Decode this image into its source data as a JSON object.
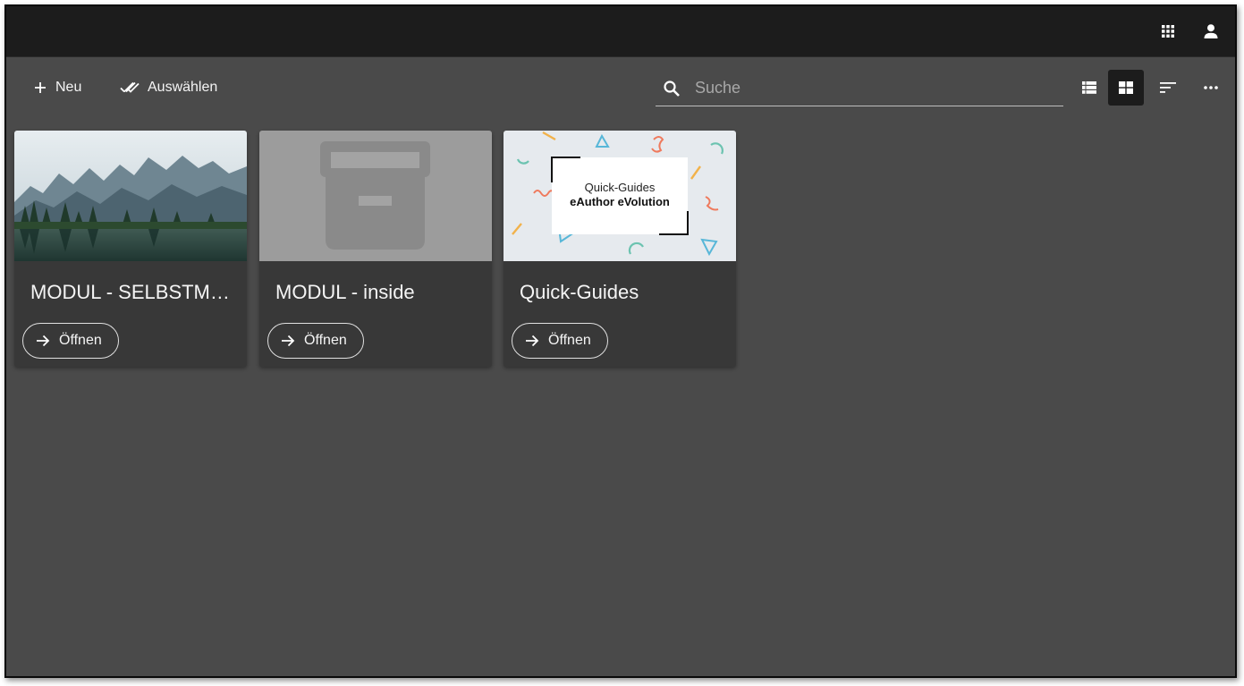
{
  "toolbar": {
    "new_label": "Neu",
    "select_label": "Auswählen",
    "search_placeholder": "Suche"
  },
  "cards": [
    {
      "title": "MODUL - SELBSTMA...",
      "open_label": "Öffnen"
    },
    {
      "title": "MODUL - inside",
      "open_label": "Öffnen"
    },
    {
      "title": "Quick-Guides",
      "open_label": "Öffnen",
      "thumb_line1": "Quick-Guides",
      "thumb_line2": "eAuthor eVolution"
    }
  ],
  "colors": {
    "topbar": "#1c1c1c",
    "background": "#4a4a4a",
    "card": "#383838",
    "active_view": "#1c1c1c"
  },
  "icons": {
    "topbar": [
      "apps-grid-icon",
      "account-icon"
    ],
    "toolbar": [
      "plus-icon",
      "double-check-icon",
      "search-icon",
      "list-view-icon",
      "grid-view-icon",
      "sort-icon",
      "more-horizontal-icon"
    ],
    "cards": [
      "arrow-right-icon"
    ]
  }
}
